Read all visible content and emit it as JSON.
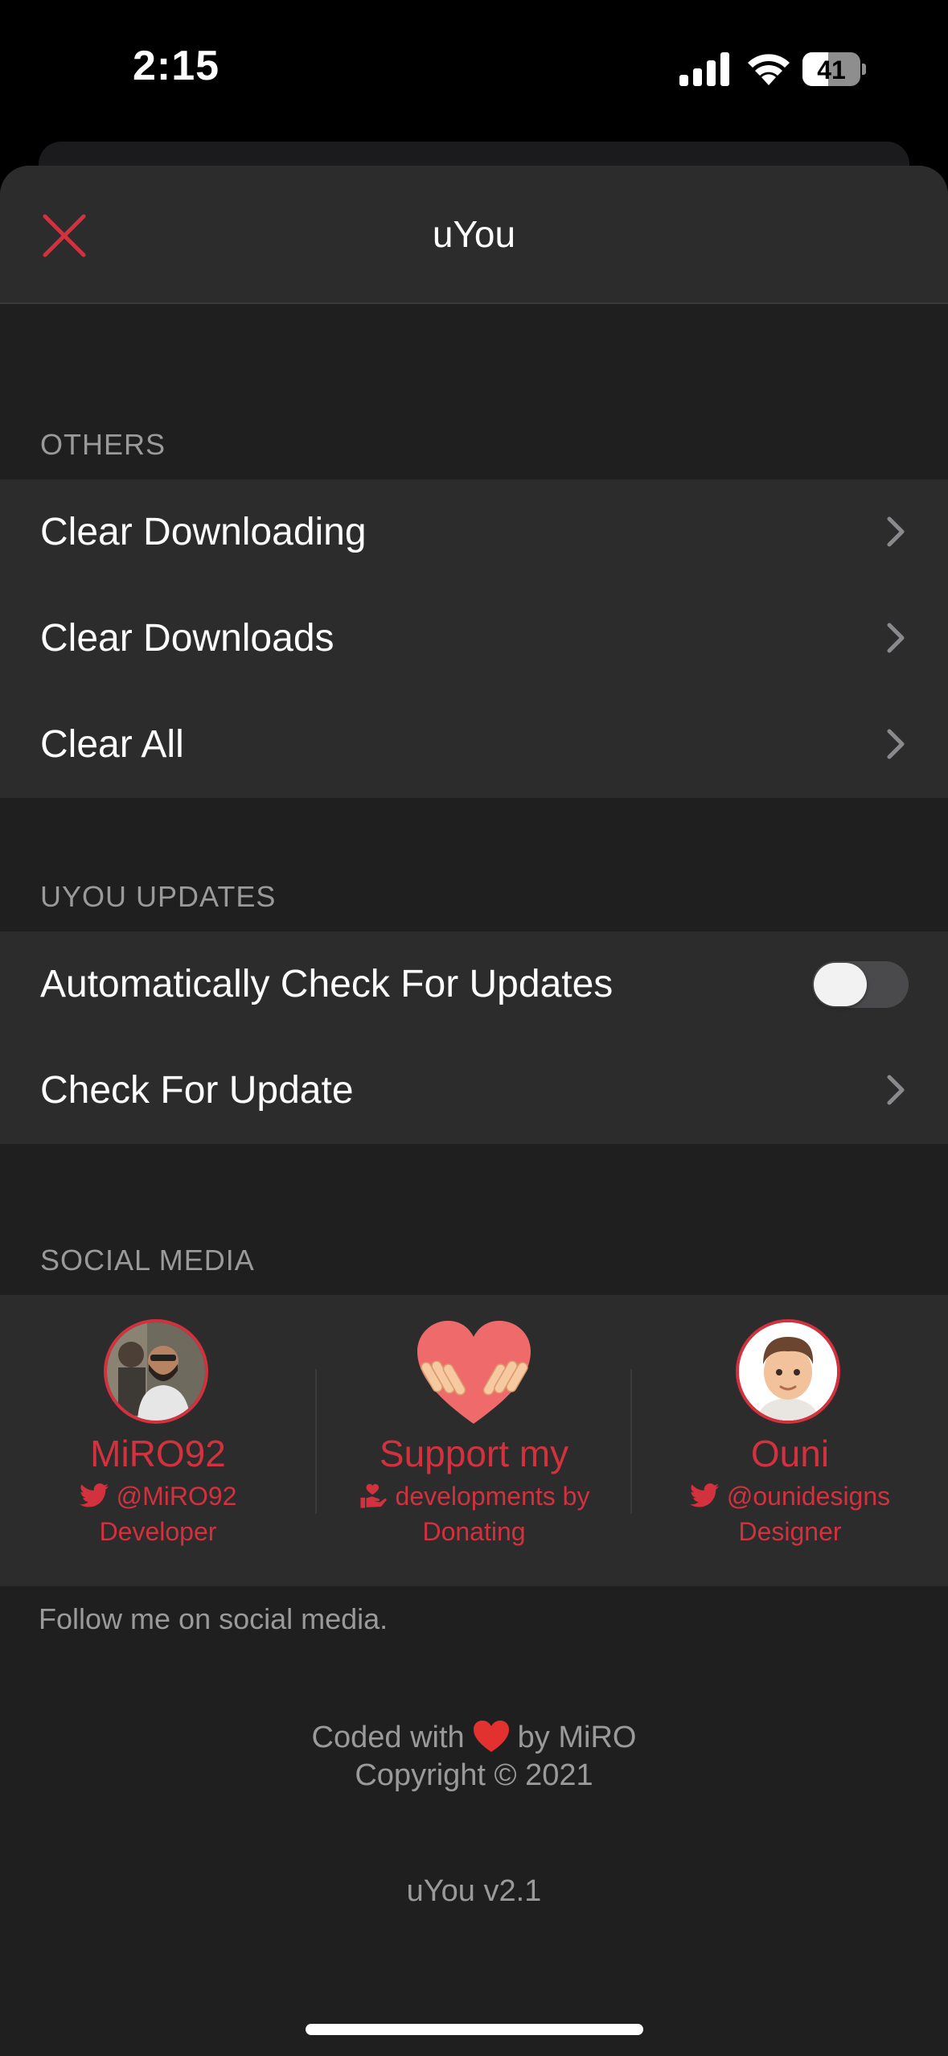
{
  "status_bar": {
    "time": "2:15",
    "battery": "41"
  },
  "nav": {
    "title": "uYou",
    "close_icon": "close-x-icon"
  },
  "sections": {
    "others": {
      "header": "OTHERS",
      "rows": [
        "Clear Downloading",
        "Clear Downloads",
        "Clear All"
      ]
    },
    "updates": {
      "header": "UYOU UPDATES",
      "toggle_label": "Automatically Check For Updates",
      "toggle_on": false,
      "check_label": "Check For Update"
    },
    "social": {
      "header": "SOCIAL MEDIA",
      "items": [
        {
          "name": "MiRO92",
          "handle": "@MiRO92",
          "role": "Developer",
          "icon": "twitter-icon"
        },
        {
          "name": "Support my",
          "handle": "developments by",
          "role": "Donating",
          "icon": "donate-icon"
        },
        {
          "name": "Ouni",
          "handle": "@ounidesigns",
          "role": "Designer",
          "icon": "twitter-icon"
        }
      ],
      "footnote": "Follow me on social media."
    }
  },
  "footer": {
    "coded_before": "Coded with",
    "coded_after": "by MiRO",
    "copyright": "Copyright © 2021",
    "version": "uYou v2.1"
  },
  "colors": {
    "accent": "#d2313e",
    "background": "#1f1f1f",
    "cell": "#2c2c2c"
  }
}
